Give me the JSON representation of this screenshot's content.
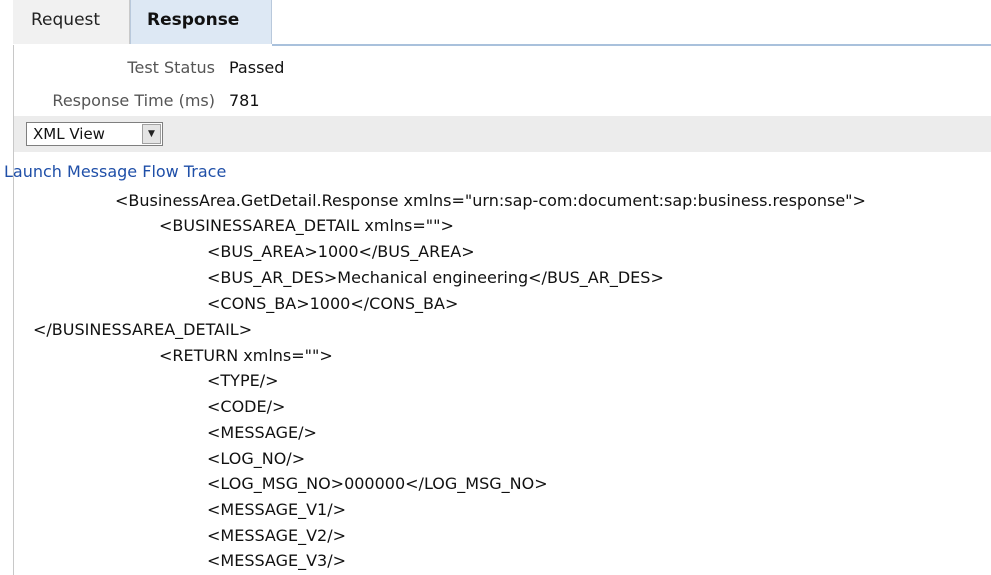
{
  "tabs": {
    "request": "Request",
    "response": "Response"
  },
  "fields": {
    "test_status_label": "Test Status",
    "test_status_value": "Passed",
    "response_time_label": "Response Time (ms)",
    "response_time_value": "781"
  },
  "view": {
    "selected": "XML View",
    "arrow_icon": "dropdown-arrow-icon"
  },
  "trace_link": "Launch Message Flow Trace",
  "xml": {
    "lines": [
      "<BusinessArea.GetDetail.Response xmlns=\"urn:sap-com:document:sap:business.response\">",
      "<BUSINESSAREA_DETAIL xmlns=\"\">",
      "<BUS_AREA>1000</BUS_AREA>",
      "<BUS_AR_DES>Mechanical engineering</BUS_AR_DES>",
      "<CONS_BA>1000</CONS_BA>",
      "</BUSINESSAREA_DETAIL>",
      "<RETURN xmlns=\"\">",
      "<TYPE/>",
      "<CODE/>",
      "<MESSAGE/>",
      "<LOG_NO/>",
      "<LOG_MSG_NO>000000</LOG_MSG_NO>",
      "<MESSAGE_V1/>",
      "<MESSAGE_V2/>",
      "<MESSAGE_V3/>"
    ]
  },
  "colors": {
    "link": "#1f4fa8",
    "active_tab": "#dde8f4",
    "tab_underline": "#a9c1dc"
  }
}
